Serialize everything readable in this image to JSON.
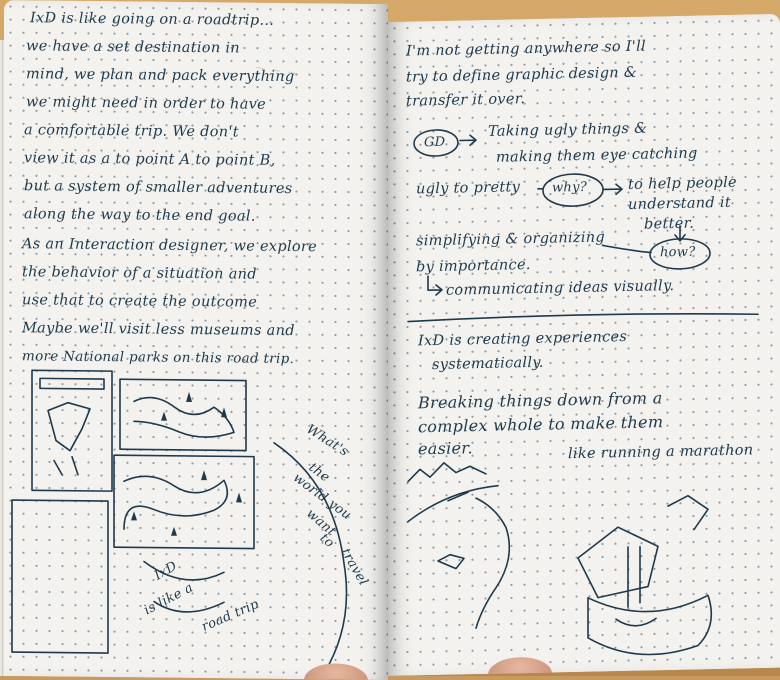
{
  "left_page": {
    "lines": [
      "IxD is like going on a roadtrip...",
      "we have a set destination in",
      "mind, we plan and pack everything",
      "we might need in order to have",
      "a comfortable trip. We don't",
      "view it as a to point A to point B,",
      "but a system of smaller adventures",
      "along the way to the end goal.",
      "As an Interaction designer, we explore",
      "the behavior of a situation and",
      "use that to create the outcome",
      "Maybe we'll visit less museums and",
      "more National parks on this road trip."
    ],
    "margin_notes": [
      "What's",
      "the",
      "world you",
      "want",
      "to",
      "travel",
      "IxD",
      "is like a",
      "road trip"
    ]
  },
  "right_page": {
    "lines": [
      "I'm not getting anywhere so I'll",
      "try to define graphic design &",
      "transfer it over."
    ],
    "gd_label": "GD",
    "flow_1": "Taking ugly things &",
    "flow_2": "making them eye catching",
    "ugly_to_pretty": "ugly to pretty",
    "why": "why?",
    "help_1": "to help people",
    "help_2": "understand it",
    "help_3": "better.",
    "simplifying": "simplifying & organizing",
    "importance": "by importance.",
    "how": "how?",
    "communicating": "communicating ideas visually.",
    "ixd_1": "IxD is creating experiences",
    "ixd_2": "systematically.",
    "break_1": "Breaking things down from a",
    "break_2": "complex whole to make them",
    "break_3": "easier.",
    "marathon": "like running a marathon"
  },
  "colors": {
    "ink": "#1f3a4d",
    "paper": "#f3f2ee",
    "table": "#c79b5f"
  }
}
